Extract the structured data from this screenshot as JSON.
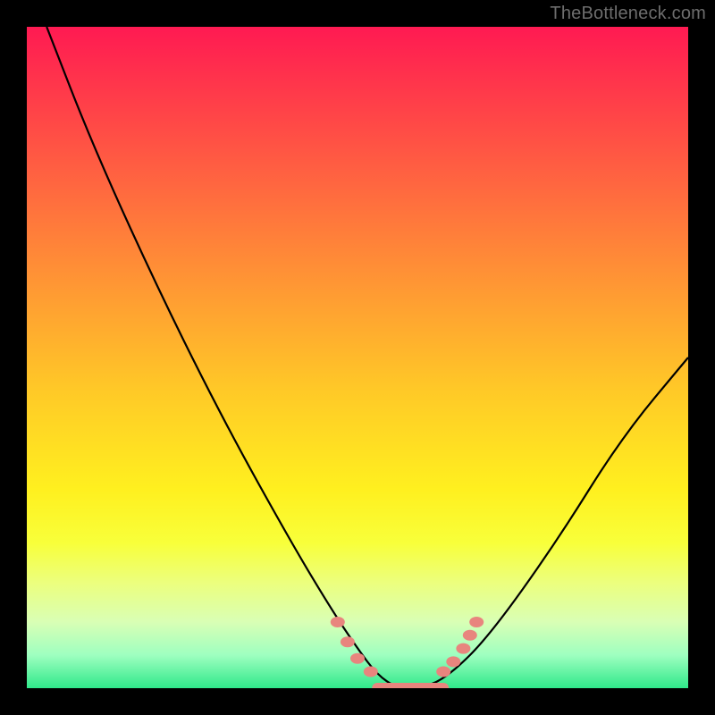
{
  "watermark": {
    "text": "TheBottleneck.com"
  },
  "chart_data": {
    "type": "line",
    "title": "",
    "xlabel": "",
    "ylabel": "",
    "xlim": [
      0,
      100
    ],
    "ylim": [
      0,
      100
    ],
    "series": [
      {
        "name": "bottleneck-curve",
        "x": [
          3,
          10,
          20,
          30,
          40,
          46,
          50,
          53,
          56,
          60,
          64,
          70,
          80,
          90,
          100
        ],
        "values": [
          100,
          82,
          60,
          40,
          22,
          12,
          6,
          2,
          0,
          0,
          2,
          8,
          22,
          38,
          50
        ]
      }
    ],
    "markers": {
      "name": "highlighted-points",
      "color": "#e8857e",
      "points": [
        {
          "x": 47,
          "y": 10
        },
        {
          "x": 48.5,
          "y": 7
        },
        {
          "x": 50,
          "y": 4.5
        },
        {
          "x": 52,
          "y": 2.5
        },
        {
          "x": 63,
          "y": 2.5
        },
        {
          "x": 64.5,
          "y": 4
        },
        {
          "x": 66,
          "y": 6
        },
        {
          "x": 67,
          "y": 8
        },
        {
          "x": 68,
          "y": 10
        }
      ],
      "flat_segment": {
        "x1": 53,
        "x2": 63,
        "y": 0
      }
    }
  }
}
